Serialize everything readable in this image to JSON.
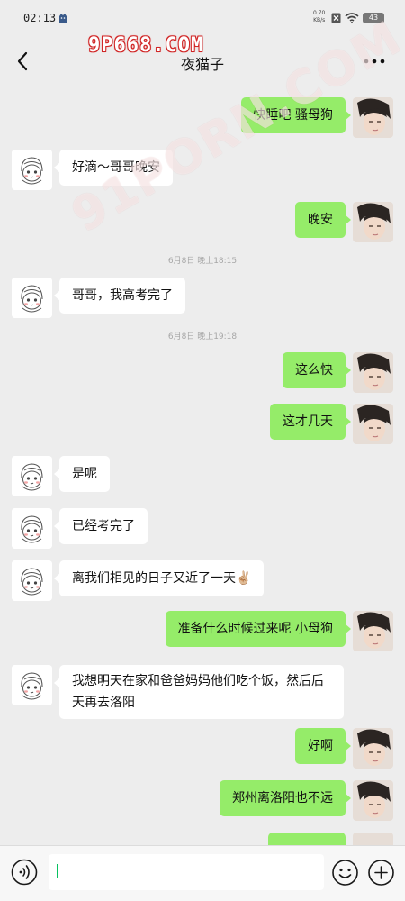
{
  "status_bar": {
    "time": "02:13",
    "net_speed_value": "0.70",
    "net_speed_unit": "KB/s",
    "battery": "43"
  },
  "nav": {
    "title": "夜猫子"
  },
  "watermarks": {
    "logo": "9P668.COM",
    "diagonal": "91PORN.COM"
  },
  "messages": [
    {
      "sender": "me",
      "text": "快睡吧 骚母狗"
    },
    {
      "sender": "other",
      "text": "好滴～哥哥晚安"
    },
    {
      "sender": "me",
      "text": "晚安"
    },
    {
      "sender": "system",
      "text": "6月8日 晚上18:15"
    },
    {
      "sender": "other",
      "text": "哥哥，我高考完了"
    },
    {
      "sender": "system",
      "text": "6月8日 晚上19:18"
    },
    {
      "sender": "me",
      "text": "这么快"
    },
    {
      "sender": "me",
      "text": "这才几天"
    },
    {
      "sender": "other",
      "text": "是呢"
    },
    {
      "sender": "other",
      "text": "已经考完了"
    },
    {
      "sender": "other",
      "text": "离我们相见的日子又近了一天✌🏼"
    },
    {
      "sender": "me",
      "text": "准备什么时候过来呢  小母狗"
    },
    {
      "sender": "other",
      "text": "我想明天在家和爸爸妈妈他们吃个饭，然后后天再去洛阳"
    },
    {
      "sender": "me",
      "text": "好啊"
    },
    {
      "sender": "me",
      "text": "郑州离洛阳也不远"
    }
  ],
  "input": {
    "value": "",
    "placeholder": ""
  },
  "colors": {
    "background": "#ededed",
    "my_bubble": "#95ec69",
    "other_bubble": "#ffffff",
    "input_caret": "#07c160"
  },
  "icons": {
    "back": "chevron-left-icon",
    "more": "more-dots-icon",
    "voice": "voice-icon",
    "emoji": "emoji-icon",
    "plus": "plus-icon"
  }
}
